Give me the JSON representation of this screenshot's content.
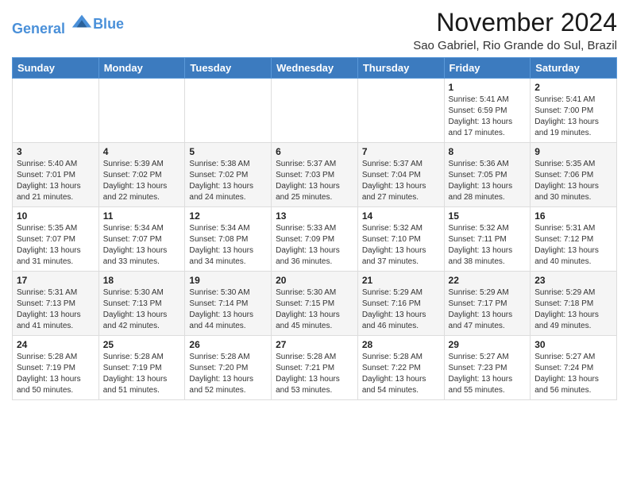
{
  "header": {
    "logo_line1": "General",
    "logo_line2": "Blue",
    "title": "November 2024",
    "subtitle": "Sao Gabriel, Rio Grande do Sul, Brazil"
  },
  "calendar": {
    "days_of_week": [
      "Sunday",
      "Monday",
      "Tuesday",
      "Wednesday",
      "Thursday",
      "Friday",
      "Saturday"
    ],
    "weeks": [
      [
        {
          "day": "",
          "sunrise": "",
          "sunset": "",
          "daylight": ""
        },
        {
          "day": "",
          "sunrise": "",
          "sunset": "",
          "daylight": ""
        },
        {
          "day": "",
          "sunrise": "",
          "sunset": "",
          "daylight": ""
        },
        {
          "day": "",
          "sunrise": "",
          "sunset": "",
          "daylight": ""
        },
        {
          "day": "",
          "sunrise": "",
          "sunset": "",
          "daylight": ""
        },
        {
          "day": "1",
          "sunrise": "Sunrise: 5:41 AM",
          "sunset": "Sunset: 6:59 PM",
          "daylight": "Daylight: 13 hours and 17 minutes."
        },
        {
          "day": "2",
          "sunrise": "Sunrise: 5:41 AM",
          "sunset": "Sunset: 7:00 PM",
          "daylight": "Daylight: 13 hours and 19 minutes."
        }
      ],
      [
        {
          "day": "3",
          "sunrise": "Sunrise: 5:40 AM",
          "sunset": "Sunset: 7:01 PM",
          "daylight": "Daylight: 13 hours and 21 minutes."
        },
        {
          "day": "4",
          "sunrise": "Sunrise: 5:39 AM",
          "sunset": "Sunset: 7:02 PM",
          "daylight": "Daylight: 13 hours and 22 minutes."
        },
        {
          "day": "5",
          "sunrise": "Sunrise: 5:38 AM",
          "sunset": "Sunset: 7:02 PM",
          "daylight": "Daylight: 13 hours and 24 minutes."
        },
        {
          "day": "6",
          "sunrise": "Sunrise: 5:37 AM",
          "sunset": "Sunset: 7:03 PM",
          "daylight": "Daylight: 13 hours and 25 minutes."
        },
        {
          "day": "7",
          "sunrise": "Sunrise: 5:37 AM",
          "sunset": "Sunset: 7:04 PM",
          "daylight": "Daylight: 13 hours and 27 minutes."
        },
        {
          "day": "8",
          "sunrise": "Sunrise: 5:36 AM",
          "sunset": "Sunset: 7:05 PM",
          "daylight": "Daylight: 13 hours and 28 minutes."
        },
        {
          "day": "9",
          "sunrise": "Sunrise: 5:35 AM",
          "sunset": "Sunset: 7:06 PM",
          "daylight": "Daylight: 13 hours and 30 minutes."
        }
      ],
      [
        {
          "day": "10",
          "sunrise": "Sunrise: 5:35 AM",
          "sunset": "Sunset: 7:07 PM",
          "daylight": "Daylight: 13 hours and 31 minutes."
        },
        {
          "day": "11",
          "sunrise": "Sunrise: 5:34 AM",
          "sunset": "Sunset: 7:07 PM",
          "daylight": "Daylight: 13 hours and 33 minutes."
        },
        {
          "day": "12",
          "sunrise": "Sunrise: 5:34 AM",
          "sunset": "Sunset: 7:08 PM",
          "daylight": "Daylight: 13 hours and 34 minutes."
        },
        {
          "day": "13",
          "sunrise": "Sunrise: 5:33 AM",
          "sunset": "Sunset: 7:09 PM",
          "daylight": "Daylight: 13 hours and 36 minutes."
        },
        {
          "day": "14",
          "sunrise": "Sunrise: 5:32 AM",
          "sunset": "Sunset: 7:10 PM",
          "daylight": "Daylight: 13 hours and 37 minutes."
        },
        {
          "day": "15",
          "sunrise": "Sunrise: 5:32 AM",
          "sunset": "Sunset: 7:11 PM",
          "daylight": "Daylight: 13 hours and 38 minutes."
        },
        {
          "day": "16",
          "sunrise": "Sunrise: 5:31 AM",
          "sunset": "Sunset: 7:12 PM",
          "daylight": "Daylight: 13 hours and 40 minutes."
        }
      ],
      [
        {
          "day": "17",
          "sunrise": "Sunrise: 5:31 AM",
          "sunset": "Sunset: 7:13 PM",
          "daylight": "Daylight: 13 hours and 41 minutes."
        },
        {
          "day": "18",
          "sunrise": "Sunrise: 5:30 AM",
          "sunset": "Sunset: 7:13 PM",
          "daylight": "Daylight: 13 hours and 42 minutes."
        },
        {
          "day": "19",
          "sunrise": "Sunrise: 5:30 AM",
          "sunset": "Sunset: 7:14 PM",
          "daylight": "Daylight: 13 hours and 44 minutes."
        },
        {
          "day": "20",
          "sunrise": "Sunrise: 5:30 AM",
          "sunset": "Sunset: 7:15 PM",
          "daylight": "Daylight: 13 hours and 45 minutes."
        },
        {
          "day": "21",
          "sunrise": "Sunrise: 5:29 AM",
          "sunset": "Sunset: 7:16 PM",
          "daylight": "Daylight: 13 hours and 46 minutes."
        },
        {
          "day": "22",
          "sunrise": "Sunrise: 5:29 AM",
          "sunset": "Sunset: 7:17 PM",
          "daylight": "Daylight: 13 hours and 47 minutes."
        },
        {
          "day": "23",
          "sunrise": "Sunrise: 5:29 AM",
          "sunset": "Sunset: 7:18 PM",
          "daylight": "Daylight: 13 hours and 49 minutes."
        }
      ],
      [
        {
          "day": "24",
          "sunrise": "Sunrise: 5:28 AM",
          "sunset": "Sunset: 7:19 PM",
          "daylight": "Daylight: 13 hours and 50 minutes."
        },
        {
          "day": "25",
          "sunrise": "Sunrise: 5:28 AM",
          "sunset": "Sunset: 7:19 PM",
          "daylight": "Daylight: 13 hours and 51 minutes."
        },
        {
          "day": "26",
          "sunrise": "Sunrise: 5:28 AM",
          "sunset": "Sunset: 7:20 PM",
          "daylight": "Daylight: 13 hours and 52 minutes."
        },
        {
          "day": "27",
          "sunrise": "Sunrise: 5:28 AM",
          "sunset": "Sunset: 7:21 PM",
          "daylight": "Daylight: 13 hours and 53 minutes."
        },
        {
          "day": "28",
          "sunrise": "Sunrise: 5:28 AM",
          "sunset": "Sunset: 7:22 PM",
          "daylight": "Daylight: 13 hours and 54 minutes."
        },
        {
          "day": "29",
          "sunrise": "Sunrise: 5:27 AM",
          "sunset": "Sunset: 7:23 PM",
          "daylight": "Daylight: 13 hours and 55 minutes."
        },
        {
          "day": "30",
          "sunrise": "Sunrise: 5:27 AM",
          "sunset": "Sunset: 7:24 PM",
          "daylight": "Daylight: 13 hours and 56 minutes."
        }
      ]
    ]
  }
}
